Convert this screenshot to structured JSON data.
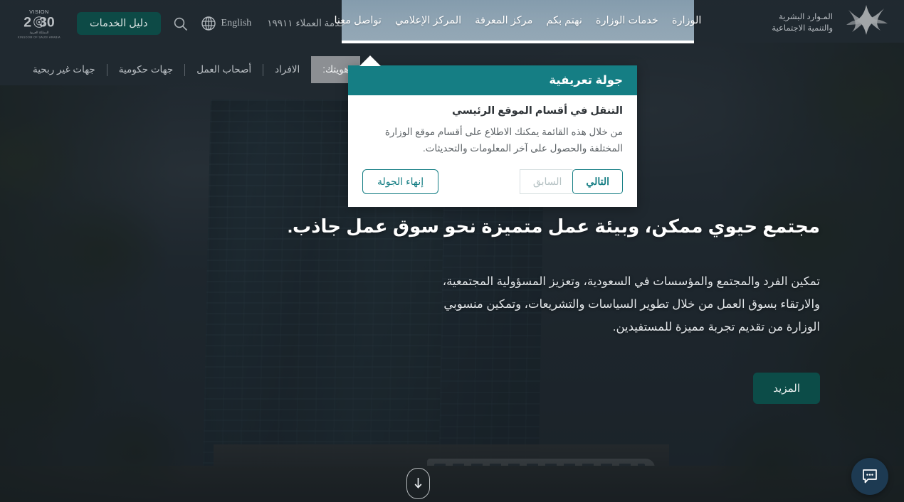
{
  "header": {
    "vision_logo_alt": "VISION 2030 KINGDOM OF SAUDI ARABIA",
    "services_guide_label": "دليل الخدمات",
    "search_icon": "search-icon",
    "language_label": "English",
    "globe_icon": "globe-icon",
    "customer_service_label": "خدمة العملاء ١٩٩١١",
    "ministry_name_line1": "المـوارد البشرية",
    "ministry_name_line2": "والتنمية الاجتماعية",
    "ministry_logo_icon": "ministry-star-icon"
  },
  "mainnav": {
    "items": [
      {
        "label": "الوزارة"
      },
      {
        "label": "خدمات الوزارة"
      },
      {
        "label": "نهتم بكم"
      },
      {
        "label": "مركز المعرفة"
      },
      {
        "label": "المركز الإعلامي"
      },
      {
        "label": "تواصل معنا"
      }
    ]
  },
  "subnav": {
    "active_tab": "هويتك:",
    "items": [
      {
        "label": "الافراد"
      },
      {
        "label": "أصحاب العمل"
      },
      {
        "label": "جهات حكومية"
      },
      {
        "label": "جهات غير ربحية"
      }
    ]
  },
  "tour": {
    "title": "جولة تعريفية",
    "step_heading": "التنقل في أقسام الموقع الرئيسي",
    "step_text": "من خلال هذه القائمة يمكنك الاطلاع على أقسام موقع الوزارة المختلفة والحصول على آخر المعلومات والتحديثات.",
    "end_label": "إنهاء الجولة",
    "next_label": "التالي",
    "prev_label": "السابق"
  },
  "hero": {
    "title": "مجتمع حيوي ممكن، وبيئة عمل متميزة نحو سوق عمل جاذب.",
    "paragraph": "تمكين الفرد والمجتمع والمؤسسات في السعودية، وتعزيز المسؤولية المجتمعية، والارتقاء بسوق العمل من خلال تطوير السياسات والتشريعات، وتمكين منسوبي الوزارة من تقديم تجربة مميزة للمستفيدين.",
    "more_label": "المزيد",
    "scroll_icon": "arrow-down-icon"
  },
  "chat": {
    "icon": "chat-bubble-icon"
  },
  "colors": {
    "teal": "#157e84",
    "dark_green": "#0c4c48",
    "dim_overlay": "rgba(24,30,36,.72)",
    "chat_bg": "#1d3a52",
    "active_tab_bg": "#8c8f93"
  }
}
